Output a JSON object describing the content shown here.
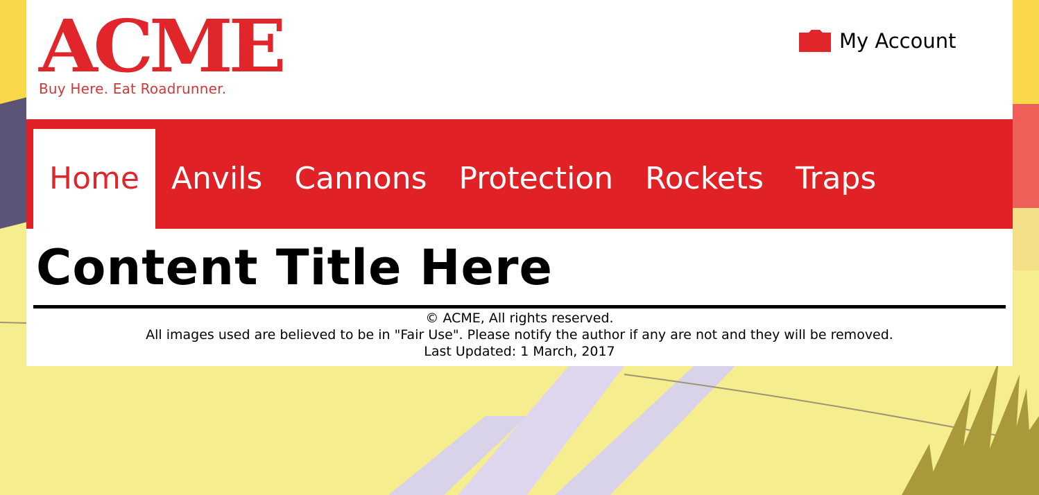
{
  "brand": {
    "name": "ACME",
    "tagline": "Buy Here. Eat Roadrunner.",
    "color": "#e0252b"
  },
  "account": {
    "label": "My Account",
    "icon": "folder-icon"
  },
  "nav": {
    "items": [
      {
        "label": "Home",
        "active": true
      },
      {
        "label": "Anvils",
        "active": false
      },
      {
        "label": "Cannons",
        "active": false
      },
      {
        "label": "Protection",
        "active": false
      },
      {
        "label": "Rockets",
        "active": false
      },
      {
        "label": "Traps",
        "active": false
      }
    ],
    "background": "#e02227"
  },
  "main": {
    "title": "Content Title Here"
  },
  "footer": {
    "copyright": "© ACME, All rights reserved.",
    "fair_use": "All images used are believed to be in \"Fair Use\". Please notify the author if any are not and they will be removed.",
    "last_updated": "Last Updated: 1 March, 2017"
  }
}
